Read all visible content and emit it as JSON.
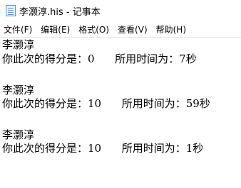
{
  "window": {
    "title": "李灏淳.his - 记事本",
    "icon": "notepad-icon"
  },
  "menu": [
    {
      "label": "文件(F)"
    },
    {
      "label": "编辑(E)"
    },
    {
      "label": "格式(O)"
    },
    {
      "label": "查看(V)"
    },
    {
      "label": "帮助(H)"
    }
  ],
  "document": {
    "lines": [
      "李灏淳",
      "你此次的得分是：0      所用时间为：7秒",
      "",
      "李灏淳",
      "你此次的得分是：10      所用时间为：59秒",
      "",
      "李灏淳",
      "你此次的得分是：10      所用时间为：1秒"
    ]
  }
}
